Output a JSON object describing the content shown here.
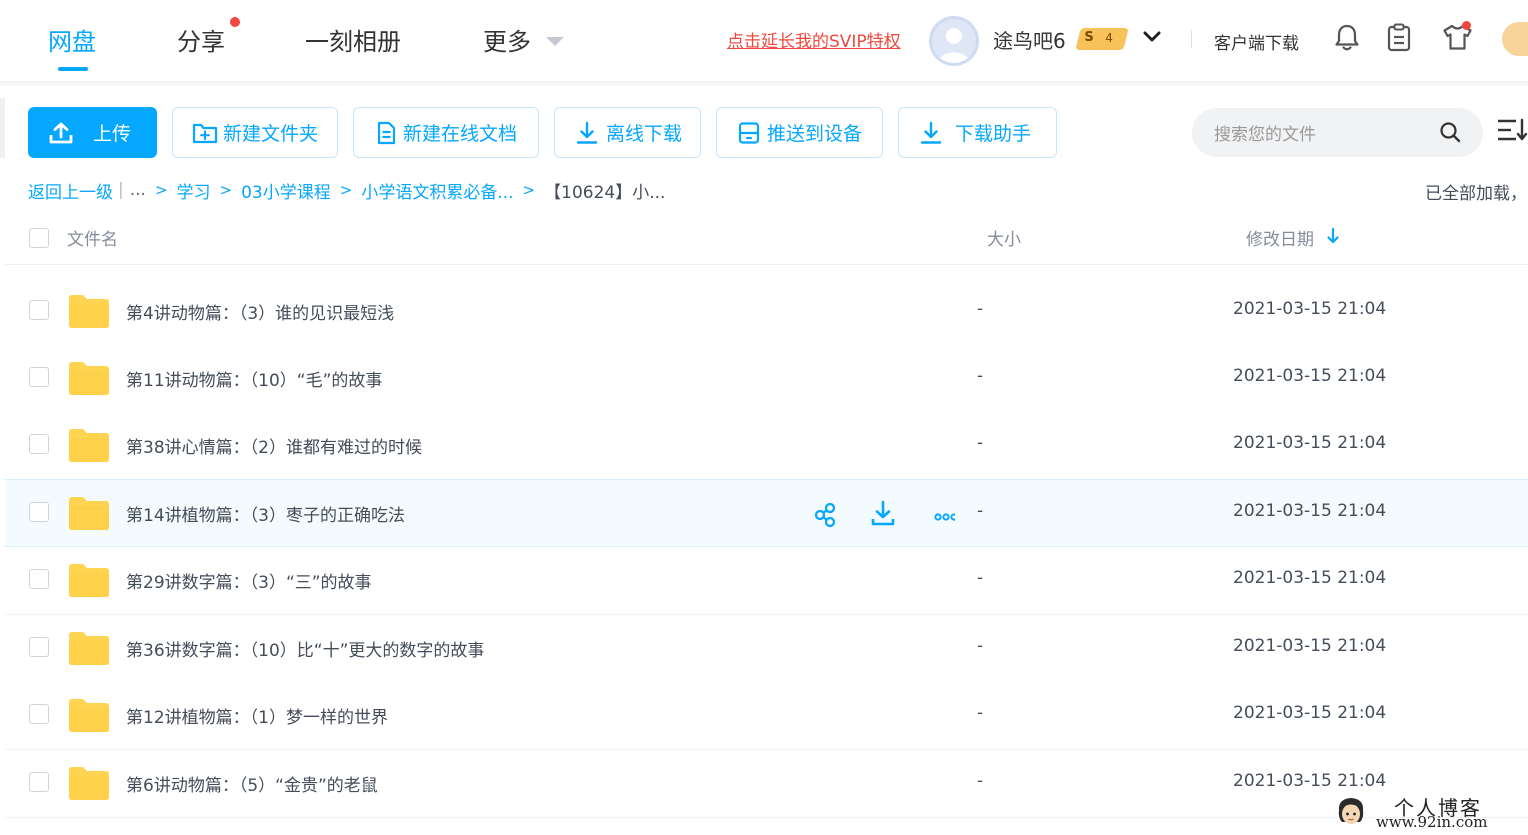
{
  "nav": {
    "tabs": [
      {
        "label": "网盘"
      },
      {
        "label": "分享"
      },
      {
        "label": "一刻相册"
      },
      {
        "label": "更多"
      }
    ],
    "svip_link": "点击延长我的SVIP特权",
    "username": "途鸟吧6",
    "svip_badge": {
      "symbol": "S",
      "level": "4"
    },
    "client_download": "客户端下载"
  },
  "toolbar": {
    "upload": "上传",
    "new_folder": "新建文件夹",
    "new_online_doc": "新建在线文档",
    "offline_download": "离线下载",
    "push_to_device": "推送到设备",
    "download_helper": "下载助手"
  },
  "search": {
    "placeholder": "搜索您的文件"
  },
  "breadcrumb": {
    "back": "返回上一级",
    "separator": "|",
    "ellipsis": "...",
    "items": [
      "学习",
      "03小学课程",
      "小学语文积累必备..."
    ],
    "current": "【10624】小..."
  },
  "loaded_status": "已全部加载，",
  "table": {
    "columns": {
      "name": "文件名",
      "size": "大小",
      "modified": "修改日期"
    },
    "sort": {
      "column": "modified",
      "direction": "desc"
    },
    "rows": [
      {
        "name": "第4讲动物篇：（3）谁的见识最短浅",
        "size": "-",
        "modified": "2021-03-15 21:04"
      },
      {
        "name": "第11讲动物篇：（10）“毛”的故事",
        "size": "-",
        "modified": "2021-03-15 21:04"
      },
      {
        "name": "第38讲心情篇：（2）谁都有难过的时候",
        "size": "-",
        "modified": "2021-03-15 21:04"
      },
      {
        "name": "第14讲植物篇：（3）枣子的正确吃法",
        "size": "-",
        "modified": "2021-03-15 21:04"
      },
      {
        "name": "第29讲数字篇：（3）“三”的故事",
        "size": "-",
        "modified": "2021-03-15 21:04"
      },
      {
        "name": "第36讲数字篇：（10）比“十”更大的数字的故事",
        "size": "-",
        "modified": "2021-03-15 21:04"
      },
      {
        "name": "第12讲植物篇：（1）梦一样的世界",
        "size": "-",
        "modified": "2021-03-15 21:04"
      },
      {
        "name": "第6讲动物篇：（5）“金贵”的老鼠",
        "size": "-",
        "modified": "2021-03-15 21:04"
      }
    ]
  },
  "watermark": {
    "title": "个人博客",
    "url": "www.92in.com"
  },
  "colors": {
    "accent": "#06a7ff",
    "danger": "#f0483e",
    "folder": "#ffd451",
    "text": "#454d5a",
    "hover_row": "#f4fbff"
  }
}
